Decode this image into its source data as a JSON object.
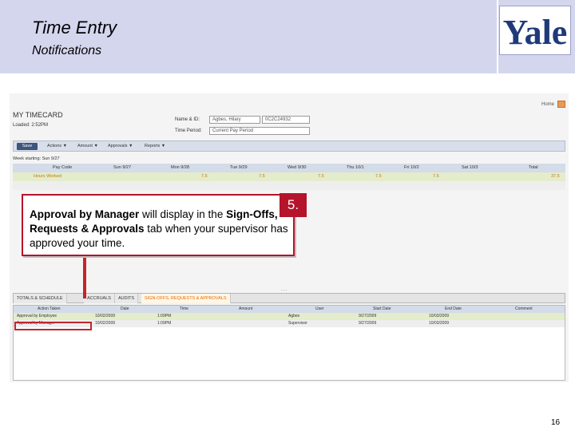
{
  "header": {
    "title": "Time Entry",
    "subtitle": "Notifications",
    "logo_text": "Yale"
  },
  "timecard": {
    "heading": "MY TIMECARD",
    "loaded": "Loaded: 2:52PM",
    "home_link": "Home",
    "name_label": "Name & ID:",
    "name_value": "Agbes, Hilary",
    "id_value": "0C2C24932",
    "period_label": "Time Period:",
    "period_value": "Current Pay Period",
    "save_label": "Save",
    "menus": [
      "Actions ▼",
      "Amount ▼",
      "Approvals ▼",
      "Reports ▼"
    ],
    "week_starting": "Week starting: Sun 9/27",
    "grid": {
      "headers": [
        "Pay Code",
        "Sun 9/27",
        "Mon 9/28",
        "Tue 9/29",
        "Wed 9/30",
        "Thu 10/1",
        "Fri 10/2",
        "Sat 10/3",
        "Total"
      ],
      "row1": [
        "Hours Worked",
        "",
        "7.5",
        "7.5",
        "7.5",
        "7.5",
        "7.5",
        "",
        "37.5"
      ],
      "row2": [
        "",
        "",
        "",
        "",
        "",
        "",
        "",
        "",
        ""
      ]
    },
    "divider": "...",
    "tabs": [
      "TOTALS & SCHEDULE",
      "ACCRUALS",
      "AUDITS",
      "SIGN-OFFS, REQUESTS & APPROVALS"
    ],
    "approvals": {
      "headers": [
        "Action Taken",
        "Date",
        "Time",
        "Amount",
        "User",
        "Start Date",
        "End Date",
        "Comment"
      ],
      "rows": [
        [
          "Approval by Employee",
          "10/02/2009",
          "1:09PM",
          "",
          "Agbes",
          "9/27/2009",
          "10/03/2009",
          ""
        ],
        [
          "Approval by Manager",
          "10/02/2009",
          "1:09PM",
          "",
          "Supervisor",
          "9/27/2009",
          "10/03/2009",
          ""
        ]
      ]
    }
  },
  "callout": {
    "step": "5.",
    "bold1": "Approval by Manager",
    "text1": " will display in the ",
    "bold2": "Sign-Offs, Requests & Approvals",
    "text2": " tab when your supervisor has approved your time."
  },
  "page_number": "16",
  "colors": {
    "header_bg": "#d4d6ee",
    "logo_blue": "#1f3a7a",
    "callout_red": "#b5142b"
  }
}
